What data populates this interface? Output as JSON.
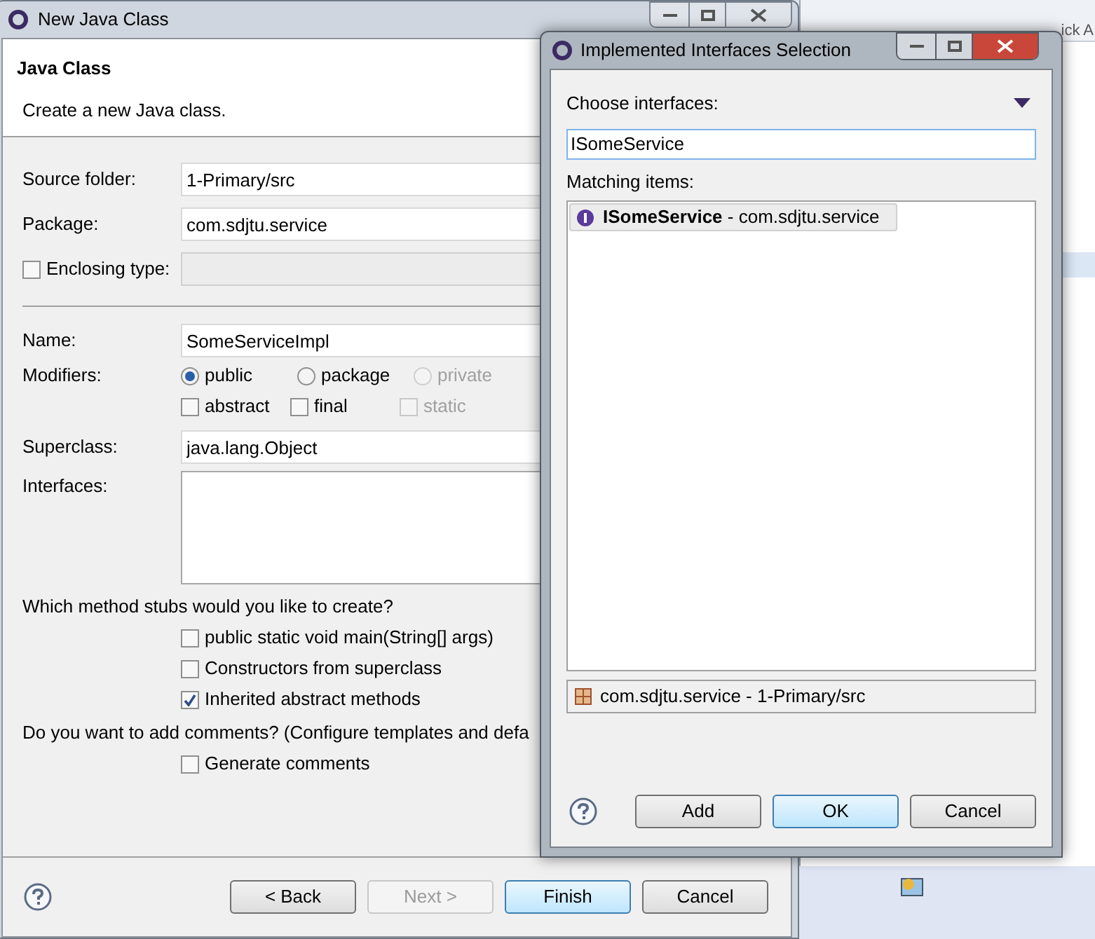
{
  "workbench": {
    "quick_access": "ick A"
  },
  "main_window": {
    "title": "New Java Class",
    "page_title": "Java Class",
    "page_description": "Create a new Java class.",
    "source_folder": {
      "label": "Source folder:",
      "value": "1-Primary/src"
    },
    "package": {
      "label": "Package:",
      "value": "com.sdjtu.service"
    },
    "enclosing_type": {
      "label": "Enclosing type:",
      "checked": false
    },
    "name": {
      "label": "Name:",
      "value": "SomeServiceImpl"
    },
    "modifiers": {
      "label": "Modifiers:",
      "access": [
        {
          "label": "public",
          "selected": true,
          "disabled": false
        },
        {
          "label": "package",
          "selected": false,
          "disabled": false
        },
        {
          "label": "private",
          "selected": false,
          "disabled": true
        }
      ],
      "flags": [
        {
          "label": "abstract",
          "checked": false,
          "disabled": false
        },
        {
          "label": "final",
          "checked": false,
          "disabled": false
        },
        {
          "label": "static",
          "checked": false,
          "disabled": true
        }
      ]
    },
    "superclass": {
      "label": "Superclass:",
      "value": "java.lang.Object"
    },
    "interfaces": {
      "label": "Interfaces:"
    },
    "stubs": {
      "question": "Which method stubs would you like to create?",
      "options": [
        {
          "label": "public static void main(String[] args)",
          "checked": false
        },
        {
          "label": "Constructors from superclass",
          "checked": false
        },
        {
          "label": "Inherited abstract methods",
          "checked": true
        }
      ]
    },
    "comments": {
      "question": "Do you want to add comments? (Configure templates and defa",
      "options": [
        {
          "label": "Generate comments",
          "checked": false
        }
      ]
    },
    "buttons": [
      {
        "label": "< Back",
        "disabled": false,
        "default": false
      },
      {
        "label": "Next >",
        "disabled": true,
        "default": false
      },
      {
        "label": "Finish",
        "disabled": false,
        "default": true
      },
      {
        "label": "Cancel",
        "disabled": false,
        "default": false
      }
    ]
  },
  "dialog": {
    "title": "Implemented Interfaces Selection",
    "choose_label": "Choose interfaces:",
    "search": {
      "value": "ISomeService"
    },
    "matching_label": "Matching items:",
    "items": [
      {
        "text": "**ISomeService** - com.sdjtu.service",
        "selected": true
      }
    ],
    "location": "com.sdjtu.service - 1-Primary/src",
    "buttons": [
      {
        "label": "Add",
        "default": false
      },
      {
        "label": "OK",
        "default": true
      },
      {
        "label": "Cancel",
        "default": false
      }
    ]
  }
}
